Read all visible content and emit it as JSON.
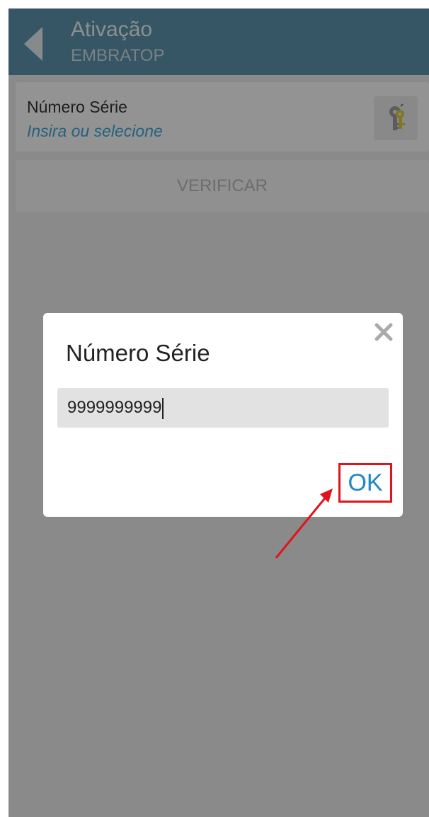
{
  "header": {
    "title": "Ativação",
    "subtitle": "EMBRATOP"
  },
  "serial_field": {
    "label": "Número Série",
    "placeholder": "Insira ou selecione"
  },
  "verify_button": {
    "label": "VERIFICAR"
  },
  "dialog": {
    "title": "Número Série",
    "input_value": "9999999999",
    "ok_label": "OK"
  },
  "icons": {
    "back": "back-arrow-icon",
    "keys": "keys-icon",
    "close": "close-icon"
  },
  "colors": {
    "header_bg": "#5d8fa9",
    "link_blue": "#3fa2d4",
    "ok_blue": "#1d88c6",
    "annotation_red": "#e0141c"
  }
}
